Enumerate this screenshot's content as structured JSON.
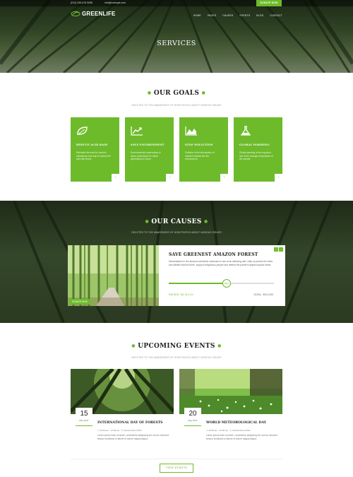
{
  "topbar": {
    "phone": "(012) 345-678 9098",
    "email": "info@example.com",
    "donate_label": "DONATE NOW"
  },
  "header": {
    "logo_text": "GREENLIFE",
    "nav": [
      "HOME",
      "PAGES",
      "CAUSES",
      "EVENTS",
      "BLOG",
      "CONTACT"
    ]
  },
  "hero": {
    "title": "SERVICES"
  },
  "goals": {
    "title": "OUR GOALS",
    "subtitle": "DEVOTED TO THE AWARENESS OF HOW PEOPLE ABOUT VARIOUS ISSUES",
    "cards": [
      {
        "icon": "leaf-icon",
        "title": "REDUCE ACID RAIN",
        "text": "Eliminate the need for harmful substances and help to reduce the acid rain levels."
      },
      {
        "icon": "chart-up-icon",
        "title": "SAVE ENVIRONMENT",
        "text": "Environmental conservation is about protecting it for future generations to come."
      },
      {
        "icon": "area-chart-icon",
        "title": "STOP POLLUTION",
        "text": "Pollution is the introduction of harmful material into the environment."
      },
      {
        "icon": "flask-icon",
        "title": "GLOBAL WARMING",
        "text": "Global warming is the long-term rise in the average temperature of the climate."
      }
    ]
  },
  "causes": {
    "title": "OUR CAUSES",
    "subtitle": "DEVOTED TO THE AWARENESS OF HOW PEOPLE ABOUT VARIOUS ISSUES",
    "card": {
      "badge": "DONATE NOW",
      "title": "SAVE GREENEST AMAZON FOREST",
      "text": "Deforestation in the Amazon rainforest continues to rise at an alarming rate. Help us protect the trees and wildlife that live there, support indigenous people and defend the planet's largest tropical forest.",
      "progress_percent": 55,
      "progress_label": "55%",
      "raised": "RAISED: $3,412.00",
      "goal": "GOAL: $10,000"
    }
  },
  "events": {
    "title": "UPCOMING EVENTS",
    "subtitle": "DEVOTED TO THE AWARENESS OF HOW PEOPLE ABOUT VARIOUS ISSUES",
    "items": [
      {
        "day": "15",
        "month": "May 2017",
        "title": "INTERNATIONAL DAY OF FORESTS",
        "time": "10:00 am - 12:00 pm",
        "place": "Central Green Park",
        "text": "Lorem ipsum dolor sit amet, consectetur adipiscing elit, sed do eiusmod tempor incididunt ut labore et dolore magna aliqua."
      },
      {
        "day": "20",
        "month": "May 2017",
        "title": "WORLD METEOROLOGICAL DAY",
        "time": "10:00 am - 12:00 pm",
        "place": "Central Green Park",
        "text": "Lorem ipsum dolor sit amet, consectetur adipiscing elit, sed do eiusmod tempor incididunt ut labore et dolore magna aliqua."
      }
    ],
    "view_all": "VIEW EVENTS"
  },
  "colors": {
    "accent": "#6dbb2b"
  }
}
